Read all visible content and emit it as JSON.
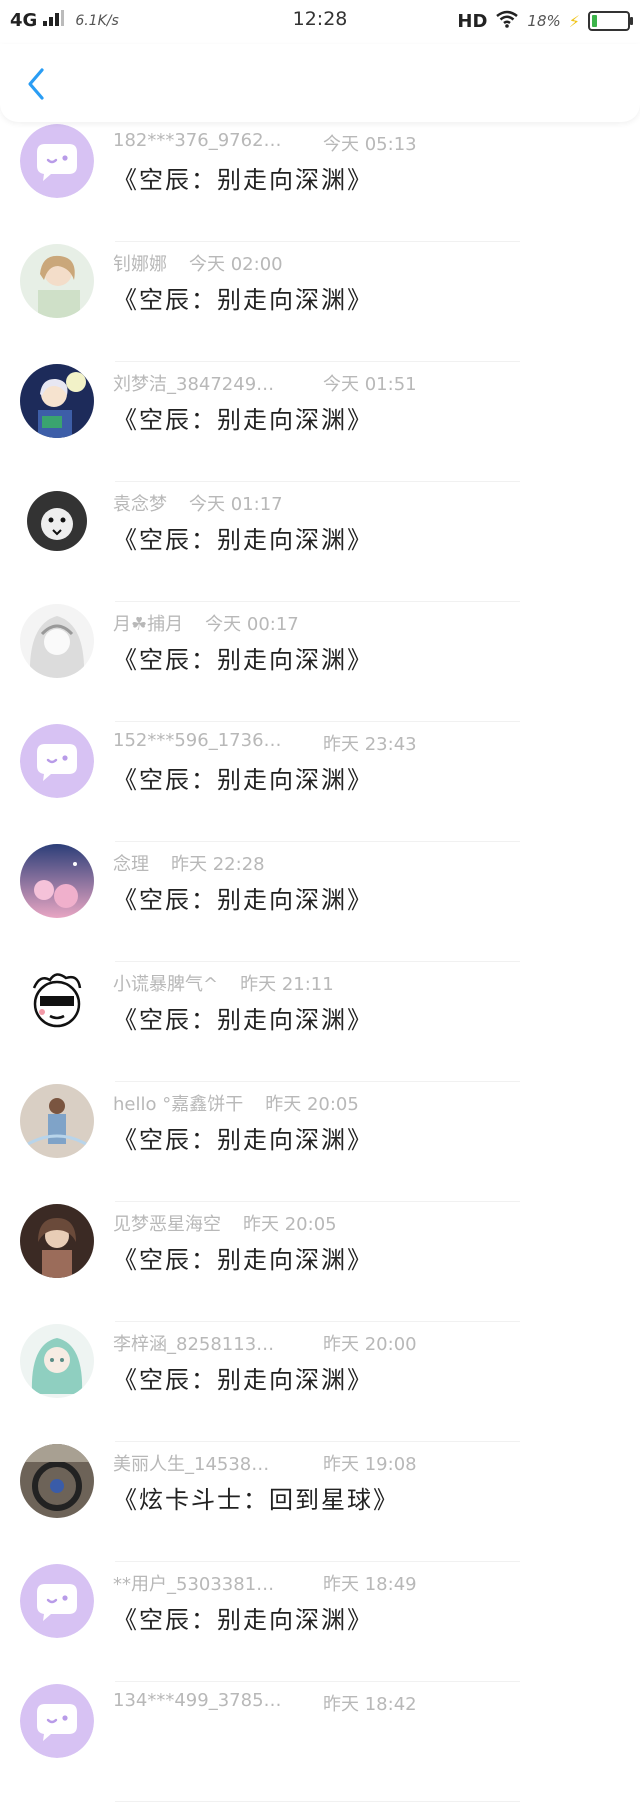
{
  "status_bar": {
    "network": "4G",
    "speed": "6.1K/s",
    "time": "12:28",
    "hd": "HD",
    "battery_pct": "18%",
    "battery_level": 0.18,
    "battery_color": "#3cb44a"
  },
  "header": {
    "back_icon": "chevron-left-icon",
    "accent": "#2a9df4"
  },
  "messages": [
    {
      "name": "182***376_9762…",
      "time": "今天 05:13",
      "text": "《空辰：别走向深渊》",
      "avatar": "default-chat-avatar"
    },
    {
      "name": "钊娜娜",
      "time": "今天 02:00",
      "text": "《空辰：别走向深渊》",
      "avatar": "photo-avatar"
    },
    {
      "name": "刘梦洁_3847249…",
      "time": "今天 01:51",
      "text": "《空辰：别走向深渊》",
      "avatar": "anime-avatar"
    },
    {
      "name": "袁念梦",
      "time": "今天 01:17",
      "text": "《空辰：别走向深渊》",
      "avatar": "lion-avatar"
    },
    {
      "name": "月☘捕月",
      "time": "今天 00:17",
      "text": "《空辰：别走向深渊》",
      "avatar": "sketch-avatar"
    },
    {
      "name": "152***596_1736…",
      "time": "昨天 23:43",
      "text": "《空辰：别走向深渊》",
      "avatar": "default-chat-avatar"
    },
    {
      "name": "念理",
      "time": "昨天 22:28",
      "text": "《空辰：别走向深渊》",
      "avatar": "sky-avatar"
    },
    {
      "name": "小谎暴脾气^",
      "time": "昨天 21:11",
      "text": "《空辰：别走向深渊》",
      "avatar": "cartoon-avatar"
    },
    {
      "name": "hello °嘉鑫饼干",
      "time": "昨天 20:05",
      "text": "《空辰：别走向深渊》",
      "avatar": "girl-avatar"
    },
    {
      "name": "见梦恶星海空",
      "time": "昨天 20:05",
      "text": "《空辰：别走向深渊》",
      "avatar": "portrait-avatar"
    },
    {
      "name": "李梓涵_8258113…",
      "time": "昨天 20:00",
      "text": "《空辰：别走向深渊》",
      "avatar": "green-hair-avatar"
    },
    {
      "name": "美丽人生_14538…",
      "time": "昨天 19:08",
      "text": "《炫卡斗士：回到星球》",
      "avatar": "car-avatar"
    },
    {
      "name": "**用户_5303381…",
      "time": "昨天 18:49",
      "text": "《空辰：别走向深渊》",
      "avatar": "default-chat-avatar"
    },
    {
      "name": "134***499_3785…",
      "time": "昨天 18:42",
      "text": "",
      "avatar": "default-chat-avatar"
    }
  ]
}
